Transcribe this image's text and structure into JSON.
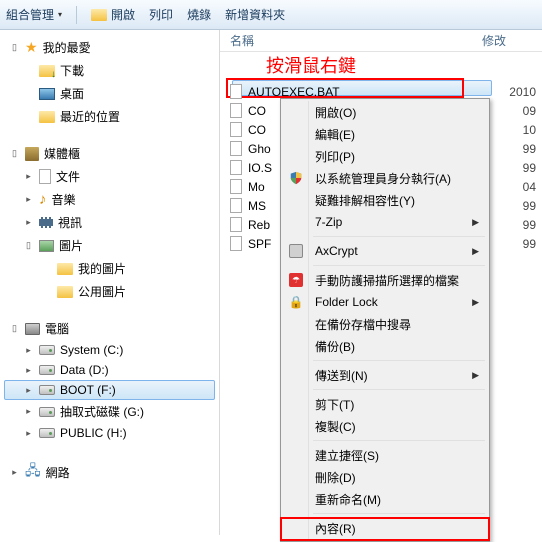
{
  "toolbar": {
    "organize": "組合管理",
    "open": "開啟",
    "print": "列印",
    "burn": "燒錄",
    "new_folder": "新增資料夾"
  },
  "sidebar": {
    "favorites": {
      "label": "我的最愛",
      "items": [
        "下載",
        "桌面",
        "最近的位置"
      ]
    },
    "libraries": {
      "label": "媒體櫃",
      "items": [
        "文件",
        "音樂",
        "視訊",
        "圖片"
      ],
      "pics_children": [
        "我的圖片",
        "公用圖片"
      ]
    },
    "computer": {
      "label": "電腦",
      "drives": [
        "System (C:)",
        "Data (D:)",
        "BOOT (F:)",
        "抽取式磁碟 (G:)",
        "PUBLIC (H:)"
      ]
    },
    "network": {
      "label": "網路"
    }
  },
  "columns": {
    "name": "名稱",
    "modified": "修改"
  },
  "annotation": "按滑鼠右鍵",
  "files": [
    {
      "name": "AUTOEXEC.BAT",
      "date": "2010"
    },
    {
      "name": "CO",
      "date": "09"
    },
    {
      "name": "CO",
      "date": "10"
    },
    {
      "name": "Gho",
      "date": "99"
    },
    {
      "name": "IO.S",
      "date": "99"
    },
    {
      "name": "Mo",
      "date": "04"
    },
    {
      "name": "MS",
      "date": "99"
    },
    {
      "name": "Reb",
      "date": "99"
    },
    {
      "name": "SPF",
      "date": "99"
    }
  ],
  "menu": {
    "open": "開啟(O)",
    "edit": "編輯(E)",
    "print": "列印(P)",
    "run_as_admin": "以系統管理員身分執行(A)",
    "troubleshoot": "疑難排解相容性(Y)",
    "sevenzip": "7-Zip",
    "axcrypt": "AxCrypt",
    "avira": "手動防護掃描所選擇的檔案",
    "folderlock": "Folder Lock",
    "backup_search": "在備份存檔中搜尋",
    "backup": "備份(B)",
    "sendto": "傳送到(N)",
    "cut": "剪下(T)",
    "copy": "複製(C)",
    "shortcut": "建立捷徑(S)",
    "delete": "刪除(D)",
    "rename": "重新命名(M)",
    "properties": "內容(R)"
  }
}
